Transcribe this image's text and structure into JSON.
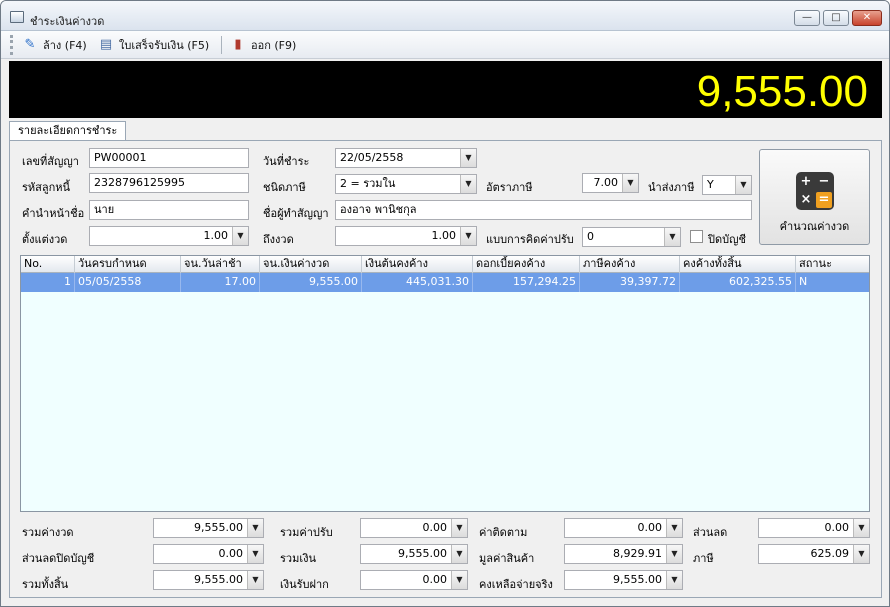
{
  "window": {
    "title": "ชำระเงินค่างวด"
  },
  "toolbar": {
    "clear": "ล้าง (F4)",
    "receipt": "ใบเสร็จรับเงิน (F5)",
    "exit": "ออก (F9)"
  },
  "display": {
    "amount": "9,555.00"
  },
  "tab": {
    "label": "รายละเอียดการชำระ"
  },
  "form": {
    "contract_no_label": "เลขที่สัญญา",
    "contract_no": "PW00001",
    "pay_date_label": "วันที่ชำระ",
    "pay_date": "22/05/2558",
    "debtor_code_label": "รหัสลูกหนี้",
    "debtor_code": "2328796125995",
    "tax_type_label": "ชนิดภาษี",
    "tax_type": "2 = รวมใน",
    "tax_rate_label": "อัตราภาษี",
    "tax_rate": "7.00",
    "submit_tax_label": "นำส่งภาษี",
    "submit_tax": "Y",
    "prefix_label": "คำนำหน้าชื่อ",
    "prefix": "นาย",
    "contract_name_label": "ชื่อผู้ทำสัญญา",
    "contract_name": "องอาจ พานิชกุล",
    "from_period_label": "ตั้งแต่งวด",
    "from_period": "1.00",
    "to_period_label": "ถึงงวด",
    "to_period": "1.00",
    "fine_mode_label": "แบบการคิดค่าปรับ",
    "fine_mode": "0",
    "close_account_label": "ปิดบัญชี",
    "calc_button": "คำนวณค่างวด"
  },
  "table": {
    "columns": [
      "No.",
      "วันครบกำหนด",
      "จน.วันล่าช้า",
      "จน.เงินค่างวด",
      "เงินต้นคงค้าง",
      "ดอกเบี้ยคงค้าง",
      "ภาษีคงค้าง",
      "คงค้างทั้งสิ้น",
      "สถานะ"
    ],
    "rows": [
      [
        "1",
        "05/05/2558",
        "17.00",
        "9,555.00",
        "445,031.30",
        "157,294.25",
        "39,397.72",
        "602,325.55",
        "N"
      ]
    ]
  },
  "summary": {
    "total_installment_label": "รวมค่างวด",
    "total_installment": "9,555.00",
    "total_fine_label": "รวมค่าปรับ",
    "total_fine": "0.00",
    "follow_fee_label": "ค่าติดตาม",
    "follow_fee": "0.00",
    "discount_label": "ส่วนลด",
    "discount": "0.00",
    "close_discount_label": "ส่วนลดปิดบัญชี",
    "close_discount": "0.00",
    "total_money_label": "รวมเงิน",
    "total_money": "9,555.00",
    "goods_value_label": "มูลค่าสินค้า",
    "goods_value": "8,929.91",
    "tax_label": "ภาษี",
    "tax": "625.09",
    "grand_total_label": "รวมทั้งสิ้น",
    "grand_total": "9,555.00",
    "deposit_label": "เงินรับฝาก",
    "deposit": "0.00",
    "net_pay_label": "คงเหลือจ่ายจริง",
    "net_pay": "9,555.00"
  }
}
